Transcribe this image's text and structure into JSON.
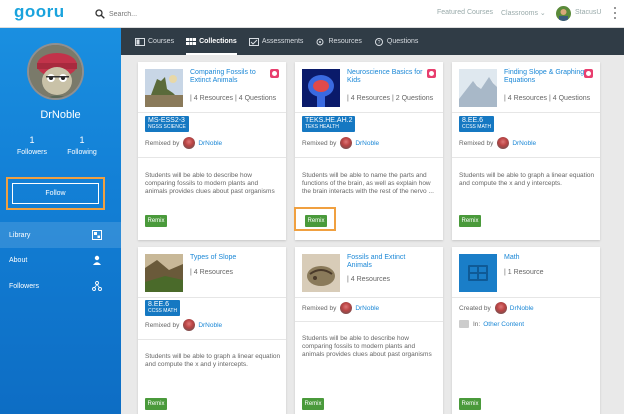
{
  "header": {
    "logo": "gooru",
    "search_placeholder": "Search...",
    "featured": "Featured Courses",
    "classrooms": "Classrooms",
    "user": "StacusU"
  },
  "sidebar": {
    "name": "DrNoble",
    "followers_count": "1",
    "followers_label": "Followers",
    "following_count": "1",
    "following_label": "Following",
    "follow_button": "Follow",
    "items": [
      {
        "label": "Library",
        "icon": "library-icon"
      },
      {
        "label": "About",
        "icon": "person-icon"
      },
      {
        "label": "Followers",
        "icon": "network-icon"
      }
    ]
  },
  "tabs": [
    {
      "label": "Courses",
      "icon": "courses-icon",
      "active": false
    },
    {
      "label": "Collections",
      "icon": "collections-icon",
      "active": true
    },
    {
      "label": "Assessments",
      "icon": "assessments-icon",
      "active": false
    },
    {
      "label": "Resources",
      "icon": "resources-icon",
      "active": false
    },
    {
      "label": "Questions",
      "icon": "questions-icon",
      "active": false
    }
  ],
  "cards": [
    {
      "title": "Comparing Fossils to Extinct Animals",
      "meta": "| 4 Resources | 4 Questions",
      "tag_code": "MS-ESS2-3",
      "tag_sub": "NGSS SCIENCE",
      "by_label": "Remixed by",
      "user": "DrNoble",
      "desc": "Students will be able to describe how comparing fossils to modern plants and animals provides clues about past organisms",
      "remix": "Remix"
    },
    {
      "title": "Neuroscience Basics for Kids",
      "meta": "| 4 Resources | 2 Questions",
      "tag_code": "TEKS.HE.AH.2",
      "tag_sub": "TEKS HEALTH",
      "by_label": "Remixed by",
      "user": "DrNoble",
      "desc": "Students will be able to name the parts and functions of the brain, as well as explain how the brain interacts with the rest of the nervo ...",
      "remix": "Remix"
    },
    {
      "title": "Finding Slope & Graphing Equations",
      "meta": "| 4 Resources | 4 Questions",
      "tag_code": "8.EE.6",
      "tag_sub": "CCSS MATH",
      "by_label": "Remixed by",
      "user": "DrNoble",
      "desc": "Students will be able to graph a linear equation and compute the x and y intercepts.",
      "remix": "Remix"
    },
    {
      "title": "Types of Slope",
      "meta": "| 4 Resources",
      "tag_code": "8.EE.6",
      "tag_sub": "CCSS MATH",
      "by_label": "Remixed by",
      "user": "DrNoble",
      "desc": "Students will be able to graph a linear equation and compute the x and y intercepts.",
      "remix": "Remix"
    },
    {
      "title": "Fossils and Extinct Animals",
      "meta": "| 4 Resources",
      "by_label": "Remixed by",
      "user": "DrNoble",
      "desc": "Students will be able to describe how comparing fossils to modern plants and animals provides clues about past organisms",
      "remix": "Remix"
    },
    {
      "title": "Math",
      "meta": "| 1 Resource",
      "by_label": "Created by",
      "user": "DrNoble",
      "other_in": "In:",
      "other_link": "Other Content",
      "remix": "Remix"
    }
  ],
  "colors": {
    "accent": "#1a87d6",
    "sidebar": "#1380d6",
    "tabbar": "#303c46",
    "remix": "#4a9a3b",
    "highlight": "#f0a040"
  }
}
